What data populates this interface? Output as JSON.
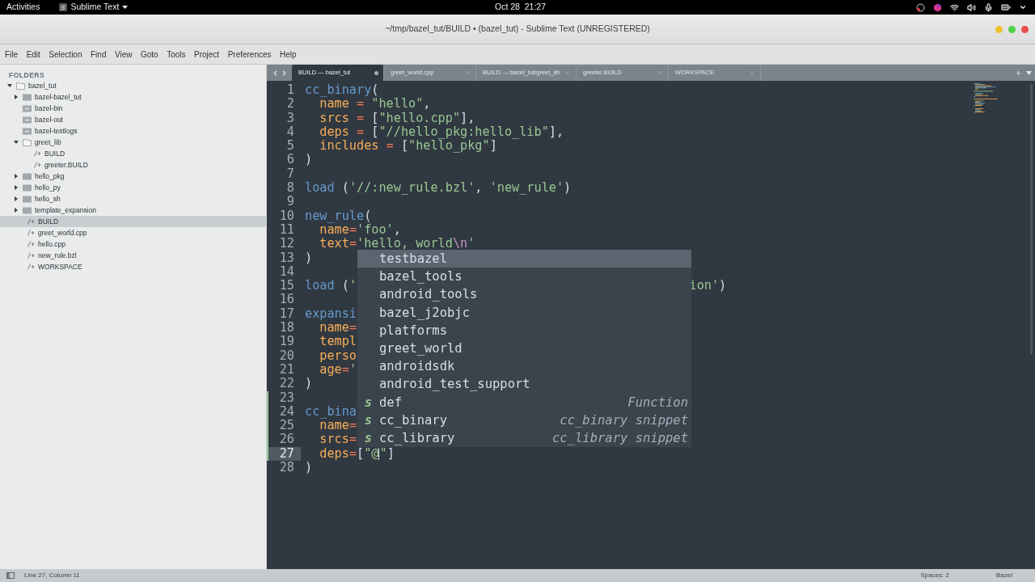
{
  "top_bar": {
    "activities": "Activities",
    "app": "Sublime Text",
    "clock": "Oct 28  21:27"
  },
  "window": {
    "title": "~/tmp/bazel_tut/BUILD • (bazel_tut) - Sublime Text (UNREGISTERED)"
  },
  "menu": [
    "File",
    "Edit",
    "Selection",
    "Find",
    "View",
    "Goto",
    "Tools",
    "Project",
    "Preferences",
    "Help"
  ],
  "sidebar": {
    "heading": "FOLDERS",
    "tree": [
      {
        "label": "bazel_tut",
        "kind": "folder",
        "expanded": true,
        "selected": false,
        "children": [
          {
            "label": "bazel-bazel_tut",
            "kind": "folder",
            "expanded": false,
            "selected": false
          },
          {
            "label": "bazel-bin",
            "kind": "link",
            "selected": false
          },
          {
            "label": "bazel-out",
            "kind": "link",
            "selected": false
          },
          {
            "label": "bazel-testlogs",
            "kind": "link",
            "selected": false
          },
          {
            "label": "greet_lib",
            "kind": "folder",
            "expanded": true,
            "selected": false,
            "children": [
              {
                "label": "BUILD",
                "kind": "file",
                "selected": false
              },
              {
                "label": "greeter.BUILD",
                "kind": "file",
                "selected": false
              }
            ]
          },
          {
            "label": "hello_pkg",
            "kind": "folder",
            "expanded": false,
            "selected": false
          },
          {
            "label": "hello_py",
            "kind": "folder",
            "expanded": false,
            "selected": false
          },
          {
            "label": "hello_sh",
            "kind": "folder",
            "expanded": false,
            "selected": false
          },
          {
            "label": "template_expansion",
            "kind": "folder",
            "expanded": false,
            "selected": false
          },
          {
            "label": "BUILD",
            "kind": "file",
            "selected": true
          },
          {
            "label": "greet_world.cpp",
            "kind": "file",
            "selected": false
          },
          {
            "label": "hello.cpp",
            "kind": "file",
            "selected": false
          },
          {
            "label": "new_rule.bzl",
            "kind": "file",
            "selected": false
          },
          {
            "label": "WORKSPACE",
            "kind": "file",
            "selected": false
          }
        ]
      }
    ]
  },
  "tabs": [
    {
      "label": "BUILD — bazel_tut",
      "selected": true,
      "dirty": true
    },
    {
      "label": "greet_world.cpp",
      "selected": false,
      "dirty": false
    },
    {
      "label": "BUILD — bazel_tut/greet_lib",
      "selected": false,
      "dirty": false
    },
    {
      "label": "greeter.BUILD",
      "selected": false,
      "dirty": false
    },
    {
      "label": "WORKSPACE",
      "selected": false,
      "dirty": false
    }
  ],
  "editor": {
    "lines": [
      {
        "n": "1",
        "modified": false,
        "current": false,
        "tokens": [
          {
            "kind": "fn",
            "text": "cc_binary"
          },
          {
            "kind": "punc",
            "text": "("
          }
        ]
      },
      {
        "n": "2",
        "modified": false,
        "current": false,
        "tokens": [
          {
            "kind": "key",
            "text": "  name"
          },
          {
            "kind": "op",
            "text": " = "
          },
          {
            "kind": "str",
            "text": "\"hello\""
          },
          {
            "kind": "punc",
            "text": ","
          }
        ]
      },
      {
        "n": "3",
        "modified": false,
        "current": false,
        "tokens": [
          {
            "kind": "key",
            "text": "  srcs"
          },
          {
            "kind": "op",
            "text": " = "
          },
          {
            "kind": "punc",
            "text": "["
          },
          {
            "kind": "str",
            "text": "\"hello.cpp\""
          },
          {
            "kind": "punc",
            "text": "],"
          }
        ]
      },
      {
        "n": "4",
        "modified": false,
        "current": false,
        "tokens": [
          {
            "kind": "key",
            "text": "  deps"
          },
          {
            "kind": "op",
            "text": " = "
          },
          {
            "kind": "punc",
            "text": "["
          },
          {
            "kind": "str",
            "text": "\"//hello_pkg:hello_lib\""
          },
          {
            "kind": "punc",
            "text": "],"
          }
        ]
      },
      {
        "n": "5",
        "modified": false,
        "current": false,
        "tokens": [
          {
            "kind": "key",
            "text": "  includes"
          },
          {
            "kind": "op",
            "text": " = "
          },
          {
            "kind": "punc",
            "text": "["
          },
          {
            "kind": "str",
            "text": "\"hello_pkg\""
          },
          {
            "kind": "punc",
            "text": "]"
          }
        ]
      },
      {
        "n": "6",
        "modified": false,
        "current": false,
        "tokens": [
          {
            "kind": "punc",
            "text": ")"
          }
        ]
      },
      {
        "n": "7",
        "modified": false,
        "current": false
      },
      {
        "n": "8",
        "modified": false,
        "current": false,
        "tokens": [
          {
            "kind": "fn",
            "text": "load"
          },
          {
            "kind": "punc",
            "text": " ("
          },
          {
            "kind": "str",
            "text": "'//:new_rule.bzl'"
          },
          {
            "kind": "punc",
            "text": ", "
          },
          {
            "kind": "str",
            "text": "'new_rule'"
          },
          {
            "kind": "punc",
            "text": ")"
          }
        ]
      },
      {
        "n": "9",
        "modified": false,
        "current": false
      },
      {
        "n": "10",
        "modified": false,
        "current": false,
        "tokens": [
          {
            "kind": "fn",
            "text": "new_rule"
          },
          {
            "kind": "punc",
            "text": "("
          }
        ]
      },
      {
        "n": "11",
        "modified": false,
        "current": false,
        "tokens": [
          {
            "kind": "key",
            "text": "  name"
          },
          {
            "kind": "op",
            "text": "="
          },
          {
            "kind": "str",
            "text": "'foo'"
          },
          {
            "kind": "punc",
            "text": ","
          }
        ]
      },
      {
        "n": "12",
        "modified": false,
        "current": false,
        "tokens": [
          {
            "kind": "key",
            "text": "  text"
          },
          {
            "kind": "op",
            "text": "="
          },
          {
            "kind": "str",
            "text": "'hello, world"
          },
          {
            "kind": "esc",
            "text": "\\n"
          },
          {
            "kind": "str",
            "text": "'"
          }
        ]
      },
      {
        "n": "13",
        "modified": false,
        "current": false,
        "tokens": [
          {
            "kind": "punc",
            "text": ")"
          }
        ]
      },
      {
        "n": "14",
        "modified": false,
        "current": false
      },
      {
        "n": "15",
        "modified": false,
        "current": false,
        "tokens": [
          {
            "kind": "fn",
            "text": "load"
          },
          {
            "kind": "punc",
            "text": " ("
          },
          {
            "kind": "str",
            "text": "'"
          }
        ],
        "right_tokens": [
          {
            "kind": "str",
            "text": "ion'"
          },
          {
            "kind": "punc",
            "text": ")"
          }
        ]
      },
      {
        "n": "16",
        "modified": false,
        "current": false
      },
      {
        "n": "17",
        "modified": false,
        "current": false,
        "tokens": [
          {
            "kind": "fn",
            "text": "expansi"
          }
        ]
      },
      {
        "n": "18",
        "modified": false,
        "current": false,
        "tokens": [
          {
            "kind": "key",
            "text": "  name"
          },
          {
            "kind": "op",
            "text": "="
          }
        ]
      },
      {
        "n": "19",
        "modified": false,
        "current": false,
        "tokens": [
          {
            "kind": "key",
            "text": "  templ"
          }
        ]
      },
      {
        "n": "20",
        "modified": false,
        "current": false,
        "tokens": [
          {
            "kind": "key",
            "text": "  perso"
          }
        ]
      },
      {
        "n": "21",
        "modified": false,
        "current": false,
        "tokens": [
          {
            "kind": "key",
            "text": "  age"
          },
          {
            "kind": "op",
            "text": "="
          },
          {
            "kind": "str",
            "text": "'"
          }
        ]
      },
      {
        "n": "22",
        "modified": false,
        "current": false,
        "tokens": [
          {
            "kind": "punc",
            "text": ")"
          }
        ]
      },
      {
        "n": "23",
        "modified": true,
        "current": false
      },
      {
        "n": "24",
        "modified": true,
        "current": false,
        "tokens": [
          {
            "kind": "fn",
            "text": "cc_bina"
          }
        ]
      },
      {
        "n": "25",
        "modified": true,
        "current": false,
        "tokens": [
          {
            "kind": "key",
            "text": "  name"
          },
          {
            "kind": "op",
            "text": "="
          }
        ]
      },
      {
        "n": "26",
        "modified": true,
        "current": false,
        "tokens": [
          {
            "kind": "key",
            "text": "  srcs"
          },
          {
            "kind": "op",
            "text": "="
          }
        ]
      },
      {
        "n": "27",
        "modified": true,
        "current": true,
        "tokens": [
          {
            "kind": "key",
            "text": "  deps"
          },
          {
            "kind": "op",
            "text": "="
          },
          {
            "kind": "punc",
            "text": "["
          },
          {
            "kind": "str",
            "text": "\"@"
          },
          {
            "kind": "caret"
          },
          {
            "kind": "str",
            "text": "\""
          },
          {
            "kind": "punc",
            "text": "]"
          }
        ]
      },
      {
        "n": "28",
        "modified": false,
        "current": false,
        "tokens": [
          {
            "kind": "punc",
            "text": ")"
          }
        ]
      }
    ],
    "completions": [
      {
        "label": "testbazel",
        "kind": "word",
        "selected": true
      },
      {
        "label": "bazel_tools",
        "kind": "word",
        "selected": false
      },
      {
        "label": "android_tools",
        "kind": "word",
        "selected": false
      },
      {
        "label": "bazel_j2objc",
        "kind": "word",
        "selected": false
      },
      {
        "label": "platforms",
        "kind": "word",
        "selected": false
      },
      {
        "label": "greet_world",
        "kind": "word",
        "selected": false
      },
      {
        "label": "androidsdk",
        "kind": "word",
        "selected": false
      },
      {
        "label": "android_test_support",
        "kind": "word",
        "selected": false
      },
      {
        "label": "def",
        "kind": "snippet",
        "selected": false,
        "badge": "s",
        "hint": "Function"
      },
      {
        "label": "cc_binary",
        "kind": "snippet",
        "selected": false,
        "badge": "s",
        "hint": "cc_binary snippet"
      },
      {
        "label": "cc_library",
        "kind": "snippet",
        "selected": false,
        "badge": "s",
        "hint": "cc_library snippet"
      }
    ]
  },
  "status_bar": {
    "position": "Line 27, Column 11",
    "indent": "Spaces: 2",
    "syntax": "Bazel"
  }
}
